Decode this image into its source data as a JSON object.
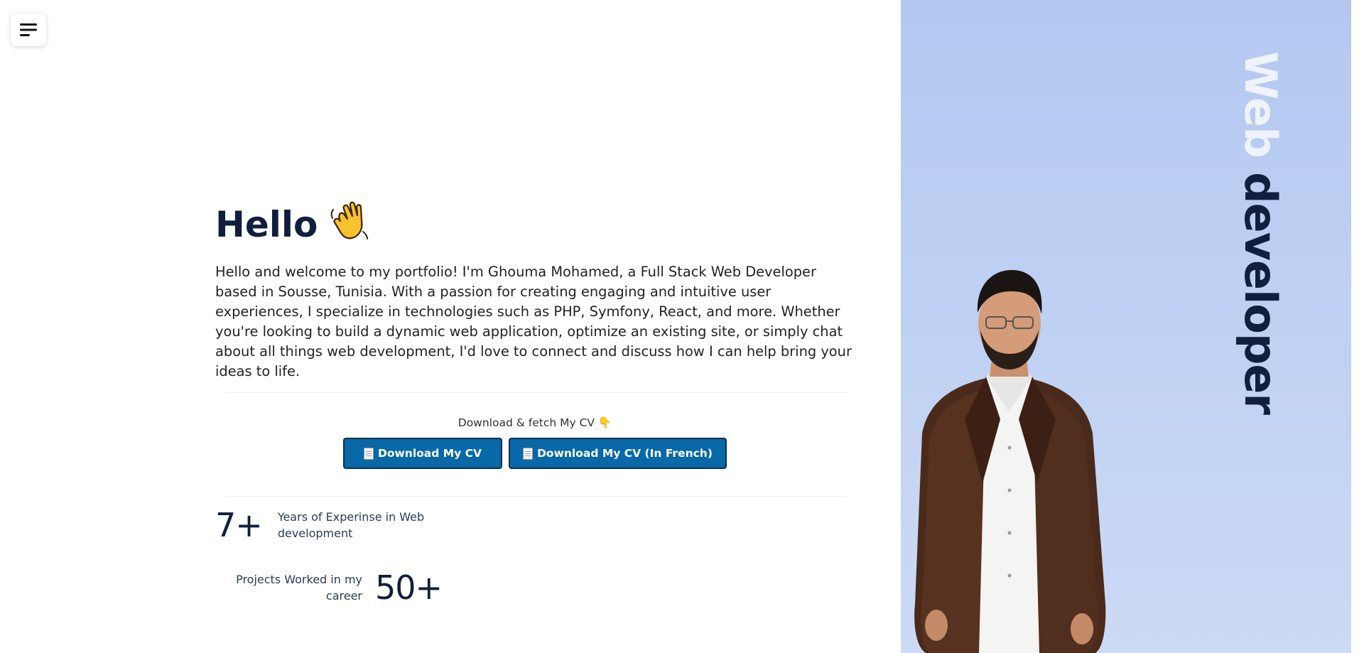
{
  "nav": {
    "menu_icon": "hamburger-menu-icon"
  },
  "hero": {
    "greeting": "Hello",
    "wave_emoji": "👋",
    "intro": "Hello and welcome to my portfolio! I'm Ghouma Mohamed, a Full Stack Web Developer based in Sousse, Tunisia. With a passion for creating engaging and intuitive user experiences, I specialize in technologies such as PHP, Symfony, React, and more. Whether you're looking to build a dynamic web application, optimize an existing site, or simply chat about all things web development, I'd love to connect and discuss how I can help bring your ideas to life."
  },
  "cv": {
    "caption": "Download & fetch My CV 👇",
    "download_label": "Download My CV",
    "download_french_label": "Download My CV (In French)",
    "button_color": "#0868a8"
  },
  "stats": {
    "years_value": "7+",
    "years_label": "Years of Experinse in Web development",
    "projects_value": "50+",
    "projects_label": "Projects Worked in my career"
  },
  "side": {
    "title_word1": "Web",
    "title_word2": "developer",
    "panel_color": "#b4c8f2"
  }
}
